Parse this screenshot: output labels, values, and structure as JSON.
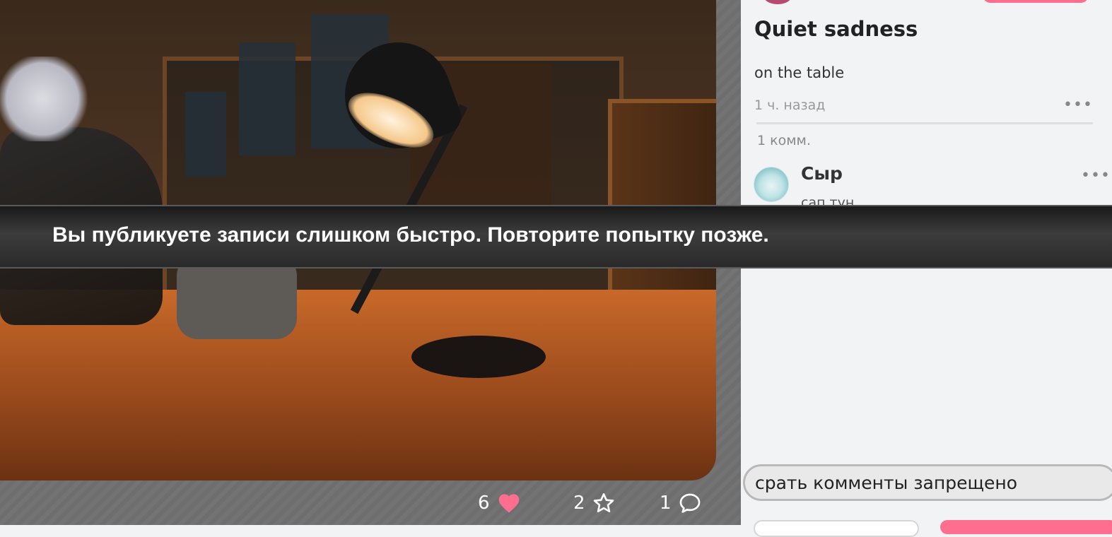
{
  "post": {
    "title": "Quiet sadness",
    "description": "on the table",
    "time_ago": "1 ч. назад",
    "more": "•••"
  },
  "comments": {
    "count_label": "1 комм.",
    "items": [
      {
        "author": "Сыр",
        "text": "сап тун",
        "more": "•••"
      }
    ]
  },
  "stats": {
    "likes": "6",
    "favorites": "2",
    "comments": "1"
  },
  "toast": {
    "message": "Вы публикуете записи слишком быстро. Повторите попытку позже."
  },
  "comment_input": {
    "value": "срать комменты запрещено"
  },
  "icons": {
    "like": "heart-icon",
    "favorite": "star-icon",
    "comment": "speech-bubble-icon",
    "more": "more-dots-icon"
  },
  "colors": {
    "accent": "#ff6e8f",
    "heart": "#ff6e8f"
  }
}
